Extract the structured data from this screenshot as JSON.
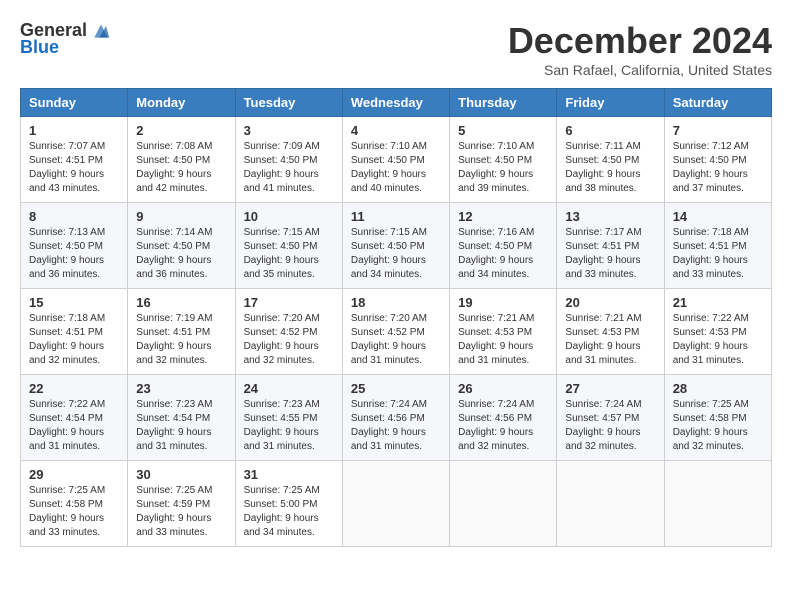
{
  "logo": {
    "general": "General",
    "blue": "Blue"
  },
  "title": "December 2024",
  "location": "San Rafael, California, United States",
  "days_of_week": [
    "Sunday",
    "Monday",
    "Tuesday",
    "Wednesday",
    "Thursday",
    "Friday",
    "Saturday"
  ],
  "weeks": [
    [
      {
        "day": "1",
        "sunrise": "7:07 AM",
        "sunset": "4:51 PM",
        "daylight": "9 hours and 43 minutes."
      },
      {
        "day": "2",
        "sunrise": "7:08 AM",
        "sunset": "4:50 PM",
        "daylight": "9 hours and 42 minutes."
      },
      {
        "day": "3",
        "sunrise": "7:09 AM",
        "sunset": "4:50 PM",
        "daylight": "9 hours and 41 minutes."
      },
      {
        "day": "4",
        "sunrise": "7:10 AM",
        "sunset": "4:50 PM",
        "daylight": "9 hours and 40 minutes."
      },
      {
        "day": "5",
        "sunrise": "7:10 AM",
        "sunset": "4:50 PM",
        "daylight": "9 hours and 39 minutes."
      },
      {
        "day": "6",
        "sunrise": "7:11 AM",
        "sunset": "4:50 PM",
        "daylight": "9 hours and 38 minutes."
      },
      {
        "day": "7",
        "sunrise": "7:12 AM",
        "sunset": "4:50 PM",
        "daylight": "9 hours and 37 minutes."
      }
    ],
    [
      {
        "day": "8",
        "sunrise": "7:13 AM",
        "sunset": "4:50 PM",
        "daylight": "9 hours and 36 minutes."
      },
      {
        "day": "9",
        "sunrise": "7:14 AM",
        "sunset": "4:50 PM",
        "daylight": "9 hours and 36 minutes."
      },
      {
        "day": "10",
        "sunrise": "7:15 AM",
        "sunset": "4:50 PM",
        "daylight": "9 hours and 35 minutes."
      },
      {
        "day": "11",
        "sunrise": "7:15 AM",
        "sunset": "4:50 PM",
        "daylight": "9 hours and 34 minutes."
      },
      {
        "day": "12",
        "sunrise": "7:16 AM",
        "sunset": "4:50 PM",
        "daylight": "9 hours and 34 minutes."
      },
      {
        "day": "13",
        "sunrise": "7:17 AM",
        "sunset": "4:51 PM",
        "daylight": "9 hours and 33 minutes."
      },
      {
        "day": "14",
        "sunrise": "7:18 AM",
        "sunset": "4:51 PM",
        "daylight": "9 hours and 33 minutes."
      }
    ],
    [
      {
        "day": "15",
        "sunrise": "7:18 AM",
        "sunset": "4:51 PM",
        "daylight": "9 hours and 32 minutes."
      },
      {
        "day": "16",
        "sunrise": "7:19 AM",
        "sunset": "4:51 PM",
        "daylight": "9 hours and 32 minutes."
      },
      {
        "day": "17",
        "sunrise": "7:20 AM",
        "sunset": "4:52 PM",
        "daylight": "9 hours and 32 minutes."
      },
      {
        "day": "18",
        "sunrise": "7:20 AM",
        "sunset": "4:52 PM",
        "daylight": "9 hours and 31 minutes."
      },
      {
        "day": "19",
        "sunrise": "7:21 AM",
        "sunset": "4:53 PM",
        "daylight": "9 hours and 31 minutes."
      },
      {
        "day": "20",
        "sunrise": "7:21 AM",
        "sunset": "4:53 PM",
        "daylight": "9 hours and 31 minutes."
      },
      {
        "day": "21",
        "sunrise": "7:22 AM",
        "sunset": "4:53 PM",
        "daylight": "9 hours and 31 minutes."
      }
    ],
    [
      {
        "day": "22",
        "sunrise": "7:22 AM",
        "sunset": "4:54 PM",
        "daylight": "9 hours and 31 minutes."
      },
      {
        "day": "23",
        "sunrise": "7:23 AM",
        "sunset": "4:54 PM",
        "daylight": "9 hours and 31 minutes."
      },
      {
        "day": "24",
        "sunrise": "7:23 AM",
        "sunset": "4:55 PM",
        "daylight": "9 hours and 31 minutes."
      },
      {
        "day": "25",
        "sunrise": "7:24 AM",
        "sunset": "4:56 PM",
        "daylight": "9 hours and 31 minutes."
      },
      {
        "day": "26",
        "sunrise": "7:24 AM",
        "sunset": "4:56 PM",
        "daylight": "9 hours and 32 minutes."
      },
      {
        "day": "27",
        "sunrise": "7:24 AM",
        "sunset": "4:57 PM",
        "daylight": "9 hours and 32 minutes."
      },
      {
        "day": "28",
        "sunrise": "7:25 AM",
        "sunset": "4:58 PM",
        "daylight": "9 hours and 32 minutes."
      }
    ],
    [
      {
        "day": "29",
        "sunrise": "7:25 AM",
        "sunset": "4:58 PM",
        "daylight": "9 hours and 33 minutes."
      },
      {
        "day": "30",
        "sunrise": "7:25 AM",
        "sunset": "4:59 PM",
        "daylight": "9 hours and 33 minutes."
      },
      {
        "day": "31",
        "sunrise": "7:25 AM",
        "sunset": "5:00 PM",
        "daylight": "9 hours and 34 minutes."
      },
      null,
      null,
      null,
      null
    ]
  ]
}
